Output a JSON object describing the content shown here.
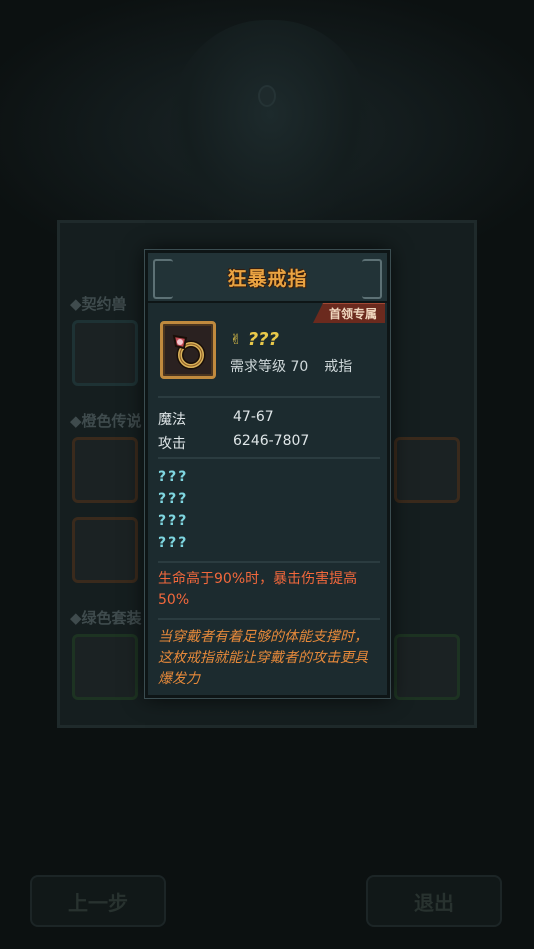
{
  "background": {
    "sections": [
      "◆契约兽",
      "◆橙色传说",
      "◆绿色套装"
    ],
    "buttons": {
      "prev": "上一步",
      "exit": "退出"
    }
  },
  "popup": {
    "title": "狂暴戒指",
    "badge": "首领专属",
    "item": {
      "icon": "ring-icon",
      "name": "???",
      "name_icon": "footprint-icon",
      "level_label": "需求等级 70",
      "type": "戒指"
    },
    "stats": [
      {
        "label": "魔法",
        "value": "47-67"
      },
      {
        "label": "攻击",
        "value": "6246-7807"
      }
    ],
    "unknown_stats": [
      "???",
      "???",
      "???",
      "???"
    ],
    "special_effect": "生命高于90%时，暴击伤害提高50%",
    "flavor_text": "当穿戴者有着足够的体能支撑时，这枚戒指就能让穿戴者的攻击更具爆发力"
  },
  "colors": {
    "title": "#e9a342",
    "item_name": "#e9c94a",
    "unknown": "#7fd6e0",
    "effect": "#f2683c",
    "flavor": "#e6893a",
    "badge": "#6b2a1e"
  }
}
